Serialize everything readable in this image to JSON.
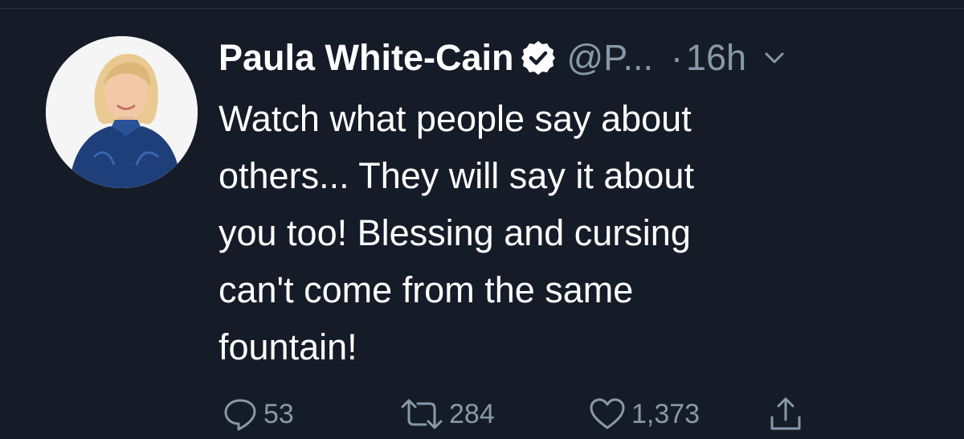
{
  "tweet": {
    "author": {
      "display_name": "Paula White-Cain",
      "verified": true,
      "handle": "@P...",
      "avatar": "avatar-photo"
    },
    "separator": "·",
    "timestamp": "16h",
    "text": "Watch what people say about\nothers... They will say it about\nyou too! Blessing and cursing\ncan't come from the same\nfountain!",
    "actions": {
      "reply": {
        "icon": "speech-bubble-icon",
        "count": "53"
      },
      "retweet": {
        "icon": "retweet-icon",
        "count": "284"
      },
      "like": {
        "icon": "heart-icon",
        "count": "1,373"
      },
      "share": {
        "icon": "share-icon"
      }
    }
  },
  "colors": {
    "background": "#151c28",
    "primary_text": "#ffffff",
    "secondary_text": "#8899a6"
  }
}
